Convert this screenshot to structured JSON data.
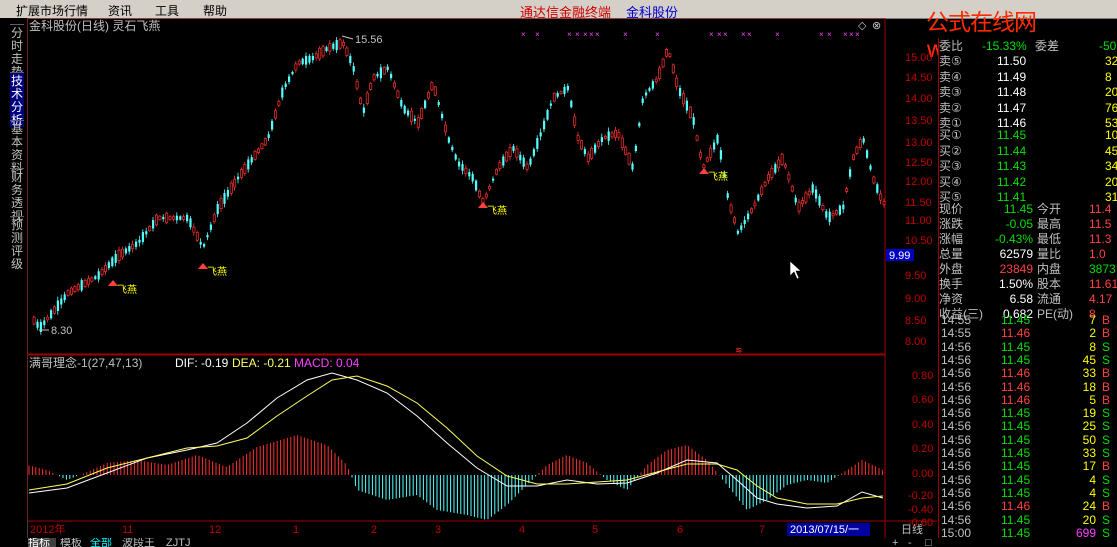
{
  "menu": [
    "扩展市场行情",
    "资讯",
    "工具",
    "帮助"
  ],
  "app_title": "通达信金融终端",
  "stock_title": "金科股份",
  "watermark": "公式在线网www.gszx.com.cn",
  "left_tabs": [
    "分时走势",
    "技术分析",
    "基本资料",
    "财务透视",
    "预测评级"
  ],
  "active_left_tab": "技术分析",
  "chart_header": "金科股份(日线) 灵石飞燕",
  "price_axis_labels": [
    "15.00",
    "14.50",
    "14.00",
    "13.50",
    "13.00",
    "12.50",
    "12.00",
    "11.50",
    "11.00",
    "10.50",
    "9.50",
    "9.00",
    "8.50",
    "8.00"
  ],
  "current_price_tag": "9.99",
  "high_label": "15.56",
  "low_label": "8.30",
  "signal_label": "飞燕",
  "macd_header": {
    "name": "满哥理念-1(27,47,13)",
    "dif": "DIF: -0.19",
    "dea": "DEA: -0.21",
    "macd": "MACD: 0.04"
  },
  "macd_axis_labels": [
    "0.80",
    "0.60",
    "0.40",
    "0.20",
    "0.00",
    "-0.20",
    "-0.40",
    "-0.60"
  ],
  "time_axis_labels": [
    "2012年",
    "11",
    "12",
    "1",
    "2",
    "3",
    "4",
    "5",
    "6",
    "7"
  ],
  "date_box": "2013/07/15/一",
  "period_label": "日线",
  "bottom_tabs": [
    "指标",
    "模板",
    "全部",
    "波段王",
    "ZJTJ"
  ],
  "scroll_buttons": [
    "+",
    "-",
    "□"
  ],
  "quote": {
    "ratio_label": "委比",
    "ratio_value": "-15.33%",
    "diff_label": "委差",
    "diff_value": "-50",
    "asks": [
      {
        "label": "卖⑤",
        "price": "11.50",
        "vol": "32"
      },
      {
        "label": "卖④",
        "price": "11.49",
        "vol": "8"
      },
      {
        "label": "卖③",
        "price": "11.48",
        "vol": "20"
      },
      {
        "label": "卖②",
        "price": "11.47",
        "vol": "76"
      },
      {
        "label": "卖①",
        "price": "11.46",
        "vol": "53"
      }
    ],
    "bids": [
      {
        "label": "买①",
        "price": "11.45",
        "vol": "10"
      },
      {
        "label": "买②",
        "price": "11.44",
        "vol": "45"
      },
      {
        "label": "买③",
        "price": "11.43",
        "vol": "34"
      },
      {
        "label": "买④",
        "price": "11.42",
        "vol": "20"
      },
      {
        "label": "买⑤",
        "price": "11.41",
        "vol": "31"
      }
    ],
    "stats": [
      [
        "现价",
        "11.45",
        "今开",
        "11.4"
      ],
      [
        "涨跌",
        "-0.05",
        "最高",
        "11.5"
      ],
      [
        "涨幅",
        "-0.43%",
        "最低",
        "11.3"
      ],
      [
        "总量",
        "62579",
        "量比",
        "1.0"
      ],
      [
        "外盘",
        "23849",
        "内盘",
        "3873"
      ],
      [
        "换手",
        "1.50%",
        "股本",
        "11.61"
      ],
      [
        "净资",
        "6.58",
        "流通",
        "4.17"
      ],
      [
        "收益(三)",
        "0.682",
        "PE(动)",
        "8"
      ]
    ]
  },
  "ticks": [
    {
      "time": "14:55",
      "price": "11.45",
      "vol": "7",
      "side": "B"
    },
    {
      "time": "14:55",
      "price": "11.46",
      "vol": "2",
      "side": "B"
    },
    {
      "time": "14:56",
      "price": "11.45",
      "vol": "8",
      "side": "S"
    },
    {
      "time": "14:56",
      "price": "11.45",
      "vol": "45",
      "side": "S"
    },
    {
      "time": "14:56",
      "price": "11.46",
      "vol": "33",
      "side": "B"
    },
    {
      "time": "14:56",
      "price": "11.46",
      "vol": "18",
      "side": "B"
    },
    {
      "time": "14:56",
      "price": "11.46",
      "vol": "5",
      "side": "B"
    },
    {
      "time": "14:56",
      "price": "11.45",
      "vol": "19",
      "side": "S"
    },
    {
      "time": "14:56",
      "price": "11.45",
      "vol": "25",
      "side": "S"
    },
    {
      "time": "14:56",
      "price": "11.45",
      "vol": "50",
      "side": "S"
    },
    {
      "time": "14:56",
      "price": "11.45",
      "vol": "33",
      "side": "S"
    },
    {
      "time": "14:56",
      "price": "11.45",
      "vol": "17",
      "side": "B"
    },
    {
      "time": "14:56",
      "price": "11.45",
      "vol": "4",
      "side": "S"
    },
    {
      "time": "14:56",
      "price": "11.45",
      "vol": "4",
      "side": "S"
    },
    {
      "time": "14:56",
      "price": "11.46",
      "vol": "24",
      "side": "B"
    },
    {
      "time": "14:56",
      "price": "11.45",
      "vol": "20",
      "side": "S"
    },
    {
      "time": "15:00",
      "price": "11.45",
      "vol": "699",
      "side": "S"
    }
  ],
  "colors": {
    "up": "#ff3030",
    "down": "#54ffff",
    "dif": "#ffffff",
    "dea": "#ffff60",
    "frame": "#a00000",
    "macd_up": "#ff3030",
    "macd_down": "#54ffff"
  }
}
